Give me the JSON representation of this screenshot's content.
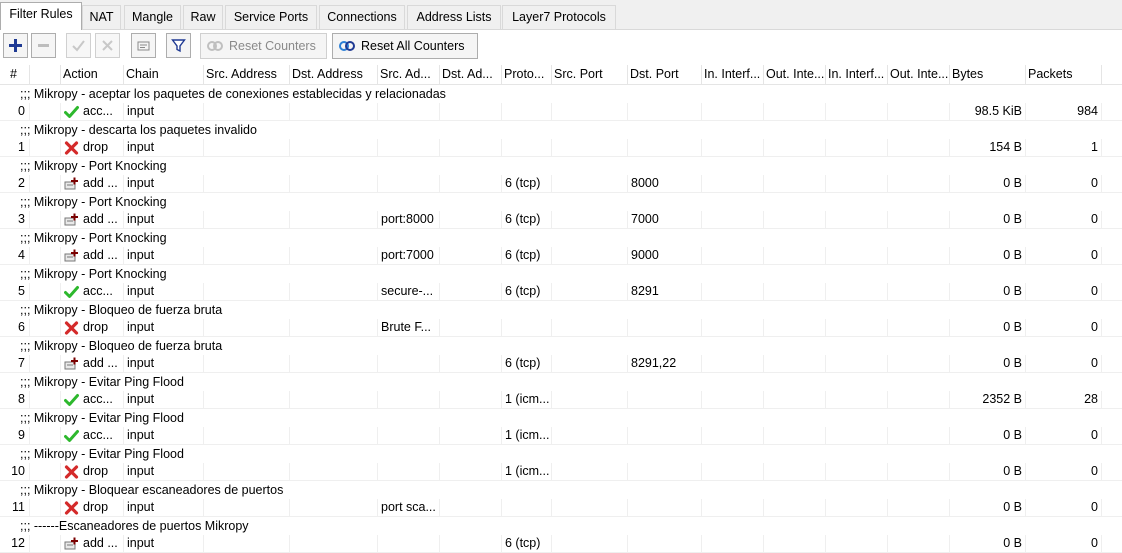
{
  "tabs": [
    {
      "label": "Filter Rules",
      "active": true
    },
    {
      "label": "NAT",
      "active": false
    },
    {
      "label": "Mangle",
      "active": false
    },
    {
      "label": "Raw",
      "active": false
    },
    {
      "label": "Service Ports",
      "active": false
    },
    {
      "label": "Connections",
      "active": false
    },
    {
      "label": "Address Lists",
      "active": false
    },
    {
      "label": "Layer7 Protocols",
      "active": false
    }
  ],
  "toolbar": {
    "add_icon": "plus-icon",
    "remove_icon": "minus-icon",
    "enable_icon": "check-icon",
    "disable_icon": "x-icon",
    "comment_icon": "note-icon",
    "filter_icon": "funnel-icon",
    "reset_counters_label": "Reset Counters",
    "reset_all_counters_label": "Reset All Counters",
    "accent_color": "#1f3a93"
  },
  "columns": [
    "#",
    "",
    "Action",
    "Chain",
    "Src. Address",
    "Dst. Address",
    "Src. Ad...",
    "Dst. Ad...",
    "Proto...",
    "Src. Port",
    "Dst. Port",
    "In. Interf...",
    "Out. Inte...",
    "In. Interf...",
    "Out. Inte...",
    "Bytes",
    "Packets"
  ],
  "rules": [
    {
      "comment": ";;; Mikropy - aceptar los paquetes de conexiones establecidas y relacionadas",
      "num": "0",
      "action_icon": "accept-check-icon",
      "action": "acc...",
      "chain": "input",
      "src_address": "",
      "dst_address": "",
      "src_list": "",
      "dst_list": "",
      "protocol": "",
      "src_port": "",
      "dst_port": "",
      "in_iface": "",
      "out_iface": "",
      "in_iface_list": "",
      "out_iface_list": "",
      "bytes": "98.5 KiB",
      "packets": "984"
    },
    {
      "comment": ";;; Mikropy - descarta los paquetes invalido",
      "num": "1",
      "action_icon": "drop-x-icon",
      "action": "drop",
      "chain": "input",
      "src_address": "",
      "dst_address": "",
      "src_list": "",
      "dst_list": "",
      "protocol": "",
      "src_port": "",
      "dst_port": "",
      "in_iface": "",
      "out_iface": "",
      "in_iface_list": "",
      "out_iface_list": "",
      "bytes": "154 B",
      "packets": "1"
    },
    {
      "comment": ";;; Mikropy - Port Knocking",
      "num": "2",
      "action_icon": "add-to-list-icon",
      "action": "add ...",
      "chain": "input",
      "src_address": "",
      "dst_address": "",
      "src_list": "",
      "dst_list": "",
      "protocol": "6 (tcp)",
      "src_port": "",
      "dst_port": "8000",
      "in_iface": "",
      "out_iface": "",
      "in_iface_list": "",
      "out_iface_list": "",
      "bytes": "0 B",
      "packets": "0"
    },
    {
      "comment": ";;; Mikropy - Port Knocking",
      "num": "3",
      "action_icon": "add-to-list-icon",
      "action": "add ...",
      "chain": "input",
      "src_address": "",
      "dst_address": "",
      "src_list": "port:8000",
      "dst_list": "",
      "protocol": "6 (tcp)",
      "src_port": "",
      "dst_port": "7000",
      "in_iface": "",
      "out_iface": "",
      "in_iface_list": "",
      "out_iface_list": "",
      "bytes": "0 B",
      "packets": "0"
    },
    {
      "comment": ";;; Mikropy - Port Knocking",
      "num": "4",
      "action_icon": "add-to-list-icon",
      "action": "add ...",
      "chain": "input",
      "src_address": "",
      "dst_address": "",
      "src_list": "port:7000",
      "dst_list": "",
      "protocol": "6 (tcp)",
      "src_port": "",
      "dst_port": "9000",
      "in_iface": "",
      "out_iface": "",
      "in_iface_list": "",
      "out_iface_list": "",
      "bytes": "0 B",
      "packets": "0"
    },
    {
      "comment": ";;; Mikropy - Port Knocking",
      "num": "5",
      "action_icon": "accept-check-icon",
      "action": "acc...",
      "chain": "input",
      "src_address": "",
      "dst_address": "",
      "src_list": "secure-...",
      "dst_list": "",
      "protocol": "6 (tcp)",
      "src_port": "",
      "dst_port": "8291",
      "in_iface": "",
      "out_iface": "",
      "in_iface_list": "",
      "out_iface_list": "",
      "bytes": "0 B",
      "packets": "0"
    },
    {
      "comment": ";;; Mikropy - Bloqueo de fuerza bruta",
      "num": "6",
      "action_icon": "drop-x-icon",
      "action": "drop",
      "chain": "input",
      "src_address": "",
      "dst_address": "",
      "src_list": "Brute F...",
      "dst_list": "",
      "protocol": "",
      "src_port": "",
      "dst_port": "",
      "in_iface": "",
      "out_iface": "",
      "in_iface_list": "",
      "out_iface_list": "",
      "bytes": "0 B",
      "packets": "0"
    },
    {
      "comment": ";;; Mikropy - Bloqueo de fuerza bruta",
      "num": "7",
      "action_icon": "add-to-list-icon",
      "action": "add ...",
      "chain": "input",
      "src_address": "",
      "dst_address": "",
      "src_list": "",
      "dst_list": "",
      "protocol": "6 (tcp)",
      "src_port": "",
      "dst_port": "8291,22",
      "in_iface": "",
      "out_iface": "",
      "in_iface_list": "",
      "out_iface_list": "",
      "bytes": "0 B",
      "packets": "0"
    },
    {
      "comment": ";;; Mikropy - Evitar Ping Flood",
      "num": "8",
      "action_icon": "accept-check-icon",
      "action": "acc...",
      "chain": "input",
      "src_address": "",
      "dst_address": "",
      "src_list": "",
      "dst_list": "",
      "protocol": "1 (icm...",
      "src_port": "",
      "dst_port": "",
      "in_iface": "",
      "out_iface": "",
      "in_iface_list": "",
      "out_iface_list": "",
      "bytes": "2352 B",
      "packets": "28"
    },
    {
      "comment": ";;; Mikropy - Evitar Ping Flood",
      "num": "9",
      "action_icon": "accept-check-icon",
      "action": "acc...",
      "chain": "input",
      "src_address": "",
      "dst_address": "",
      "src_list": "",
      "dst_list": "",
      "protocol": "1 (icm...",
      "src_port": "",
      "dst_port": "",
      "in_iface": "",
      "out_iface": "",
      "in_iface_list": "",
      "out_iface_list": "",
      "bytes": "0 B",
      "packets": "0"
    },
    {
      "comment": ";;; Mikropy - Evitar Ping Flood",
      "num": "10",
      "action_icon": "drop-x-icon",
      "action": "drop",
      "chain": "input",
      "src_address": "",
      "dst_address": "",
      "src_list": "",
      "dst_list": "",
      "protocol": "1 (icm...",
      "src_port": "",
      "dst_port": "",
      "in_iface": "",
      "out_iface": "",
      "in_iface_list": "",
      "out_iface_list": "",
      "bytes": "0 B",
      "packets": "0"
    },
    {
      "comment": ";;; Mikropy - Bloquear escaneadores de puertos",
      "num": "11",
      "action_icon": "drop-x-icon",
      "action": "drop",
      "chain": "input",
      "src_address": "",
      "dst_address": "",
      "src_list": "port sca...",
      "dst_list": "",
      "protocol": "",
      "src_port": "",
      "dst_port": "",
      "in_iface": "",
      "out_iface": "",
      "in_iface_list": "",
      "out_iface_list": "",
      "bytes": "0 B",
      "packets": "0"
    },
    {
      "comment": ";;; ------Escaneadores de puertos Mikropy",
      "num": "12",
      "action_icon": "add-to-list-icon",
      "action": "add ...",
      "chain": "input",
      "src_address": "",
      "dst_address": "",
      "src_list": "",
      "dst_list": "",
      "protocol": "6 (tcp)",
      "src_port": "",
      "dst_port": "",
      "in_iface": "",
      "out_iface": "",
      "in_iface_list": "",
      "out_iface_list": "",
      "bytes": "0 B",
      "packets": "0"
    }
  ],
  "colors": {
    "accept": "#2db82d",
    "drop": "#d42a2a",
    "add": "#7a0000"
  }
}
